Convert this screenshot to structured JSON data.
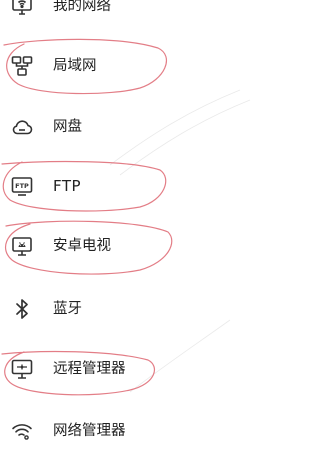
{
  "menu": {
    "items": [
      {
        "label": "我的网络",
        "icon": "network-monitor-icon"
      },
      {
        "label": "局域网",
        "icon": "lan-icon"
      },
      {
        "label": "网盘",
        "icon": "cloud-icon"
      },
      {
        "label": "FTP",
        "icon": "ftp-icon"
      },
      {
        "label": "安卓电视",
        "icon": "android-tv-icon"
      },
      {
        "label": "蓝牙",
        "icon": "bluetooth-icon"
      },
      {
        "label": "远程管理器",
        "icon": "remote-manager-icon"
      },
      {
        "label": "网络管理器",
        "icon": "network-manager-icon"
      }
    ]
  },
  "colors": {
    "annotation": "#e0707a",
    "icon": "#333333",
    "text": "#222222"
  }
}
